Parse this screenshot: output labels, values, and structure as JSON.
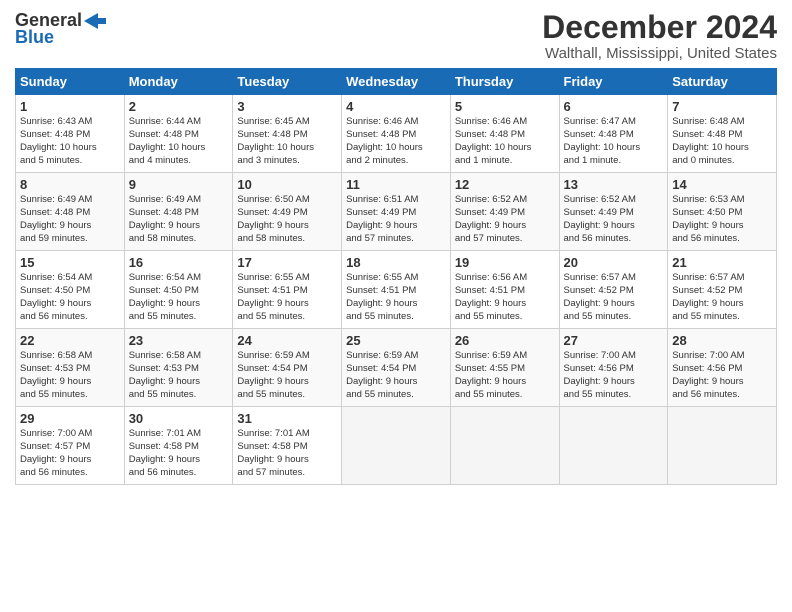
{
  "logo": {
    "line1": "General",
    "line2": "Blue"
  },
  "title": "December 2024",
  "subtitle": "Walthall, Mississippi, United States",
  "days_of_week": [
    "Sunday",
    "Monday",
    "Tuesday",
    "Wednesday",
    "Thursday",
    "Friday",
    "Saturday"
  ],
  "weeks": [
    [
      {
        "day": "1",
        "info": "Sunrise: 6:43 AM\nSunset: 4:48 PM\nDaylight: 10 hours\nand 5 minutes."
      },
      {
        "day": "2",
        "info": "Sunrise: 6:44 AM\nSunset: 4:48 PM\nDaylight: 10 hours\nand 4 minutes."
      },
      {
        "day": "3",
        "info": "Sunrise: 6:45 AM\nSunset: 4:48 PM\nDaylight: 10 hours\nand 3 minutes."
      },
      {
        "day": "4",
        "info": "Sunrise: 6:46 AM\nSunset: 4:48 PM\nDaylight: 10 hours\nand 2 minutes."
      },
      {
        "day": "5",
        "info": "Sunrise: 6:46 AM\nSunset: 4:48 PM\nDaylight: 10 hours\nand 1 minute."
      },
      {
        "day": "6",
        "info": "Sunrise: 6:47 AM\nSunset: 4:48 PM\nDaylight: 10 hours\nand 1 minute."
      },
      {
        "day": "7",
        "info": "Sunrise: 6:48 AM\nSunset: 4:48 PM\nDaylight: 10 hours\nand 0 minutes."
      }
    ],
    [
      {
        "day": "8",
        "info": "Sunrise: 6:49 AM\nSunset: 4:48 PM\nDaylight: 9 hours\nand 59 minutes."
      },
      {
        "day": "9",
        "info": "Sunrise: 6:49 AM\nSunset: 4:48 PM\nDaylight: 9 hours\nand 58 minutes."
      },
      {
        "day": "10",
        "info": "Sunrise: 6:50 AM\nSunset: 4:49 PM\nDaylight: 9 hours\nand 58 minutes."
      },
      {
        "day": "11",
        "info": "Sunrise: 6:51 AM\nSunset: 4:49 PM\nDaylight: 9 hours\nand 57 minutes."
      },
      {
        "day": "12",
        "info": "Sunrise: 6:52 AM\nSunset: 4:49 PM\nDaylight: 9 hours\nand 57 minutes."
      },
      {
        "day": "13",
        "info": "Sunrise: 6:52 AM\nSunset: 4:49 PM\nDaylight: 9 hours\nand 56 minutes."
      },
      {
        "day": "14",
        "info": "Sunrise: 6:53 AM\nSunset: 4:50 PM\nDaylight: 9 hours\nand 56 minutes."
      }
    ],
    [
      {
        "day": "15",
        "info": "Sunrise: 6:54 AM\nSunset: 4:50 PM\nDaylight: 9 hours\nand 56 minutes."
      },
      {
        "day": "16",
        "info": "Sunrise: 6:54 AM\nSunset: 4:50 PM\nDaylight: 9 hours\nand 55 minutes."
      },
      {
        "day": "17",
        "info": "Sunrise: 6:55 AM\nSunset: 4:51 PM\nDaylight: 9 hours\nand 55 minutes."
      },
      {
        "day": "18",
        "info": "Sunrise: 6:55 AM\nSunset: 4:51 PM\nDaylight: 9 hours\nand 55 minutes."
      },
      {
        "day": "19",
        "info": "Sunrise: 6:56 AM\nSunset: 4:51 PM\nDaylight: 9 hours\nand 55 minutes."
      },
      {
        "day": "20",
        "info": "Sunrise: 6:57 AM\nSunset: 4:52 PM\nDaylight: 9 hours\nand 55 minutes."
      },
      {
        "day": "21",
        "info": "Sunrise: 6:57 AM\nSunset: 4:52 PM\nDaylight: 9 hours\nand 55 minutes."
      }
    ],
    [
      {
        "day": "22",
        "info": "Sunrise: 6:58 AM\nSunset: 4:53 PM\nDaylight: 9 hours\nand 55 minutes."
      },
      {
        "day": "23",
        "info": "Sunrise: 6:58 AM\nSunset: 4:53 PM\nDaylight: 9 hours\nand 55 minutes."
      },
      {
        "day": "24",
        "info": "Sunrise: 6:59 AM\nSunset: 4:54 PM\nDaylight: 9 hours\nand 55 minutes."
      },
      {
        "day": "25",
        "info": "Sunrise: 6:59 AM\nSunset: 4:54 PM\nDaylight: 9 hours\nand 55 minutes."
      },
      {
        "day": "26",
        "info": "Sunrise: 6:59 AM\nSunset: 4:55 PM\nDaylight: 9 hours\nand 55 minutes."
      },
      {
        "day": "27",
        "info": "Sunrise: 7:00 AM\nSunset: 4:56 PM\nDaylight: 9 hours\nand 55 minutes."
      },
      {
        "day": "28",
        "info": "Sunrise: 7:00 AM\nSunset: 4:56 PM\nDaylight: 9 hours\nand 56 minutes."
      }
    ],
    [
      {
        "day": "29",
        "info": "Sunrise: 7:00 AM\nSunset: 4:57 PM\nDaylight: 9 hours\nand 56 minutes."
      },
      {
        "day": "30",
        "info": "Sunrise: 7:01 AM\nSunset: 4:58 PM\nDaylight: 9 hours\nand 56 minutes."
      },
      {
        "day": "31",
        "info": "Sunrise: 7:01 AM\nSunset: 4:58 PM\nDaylight: 9 hours\nand 57 minutes."
      },
      {
        "day": "",
        "info": ""
      },
      {
        "day": "",
        "info": ""
      },
      {
        "day": "",
        "info": ""
      },
      {
        "day": "",
        "info": ""
      }
    ]
  ]
}
